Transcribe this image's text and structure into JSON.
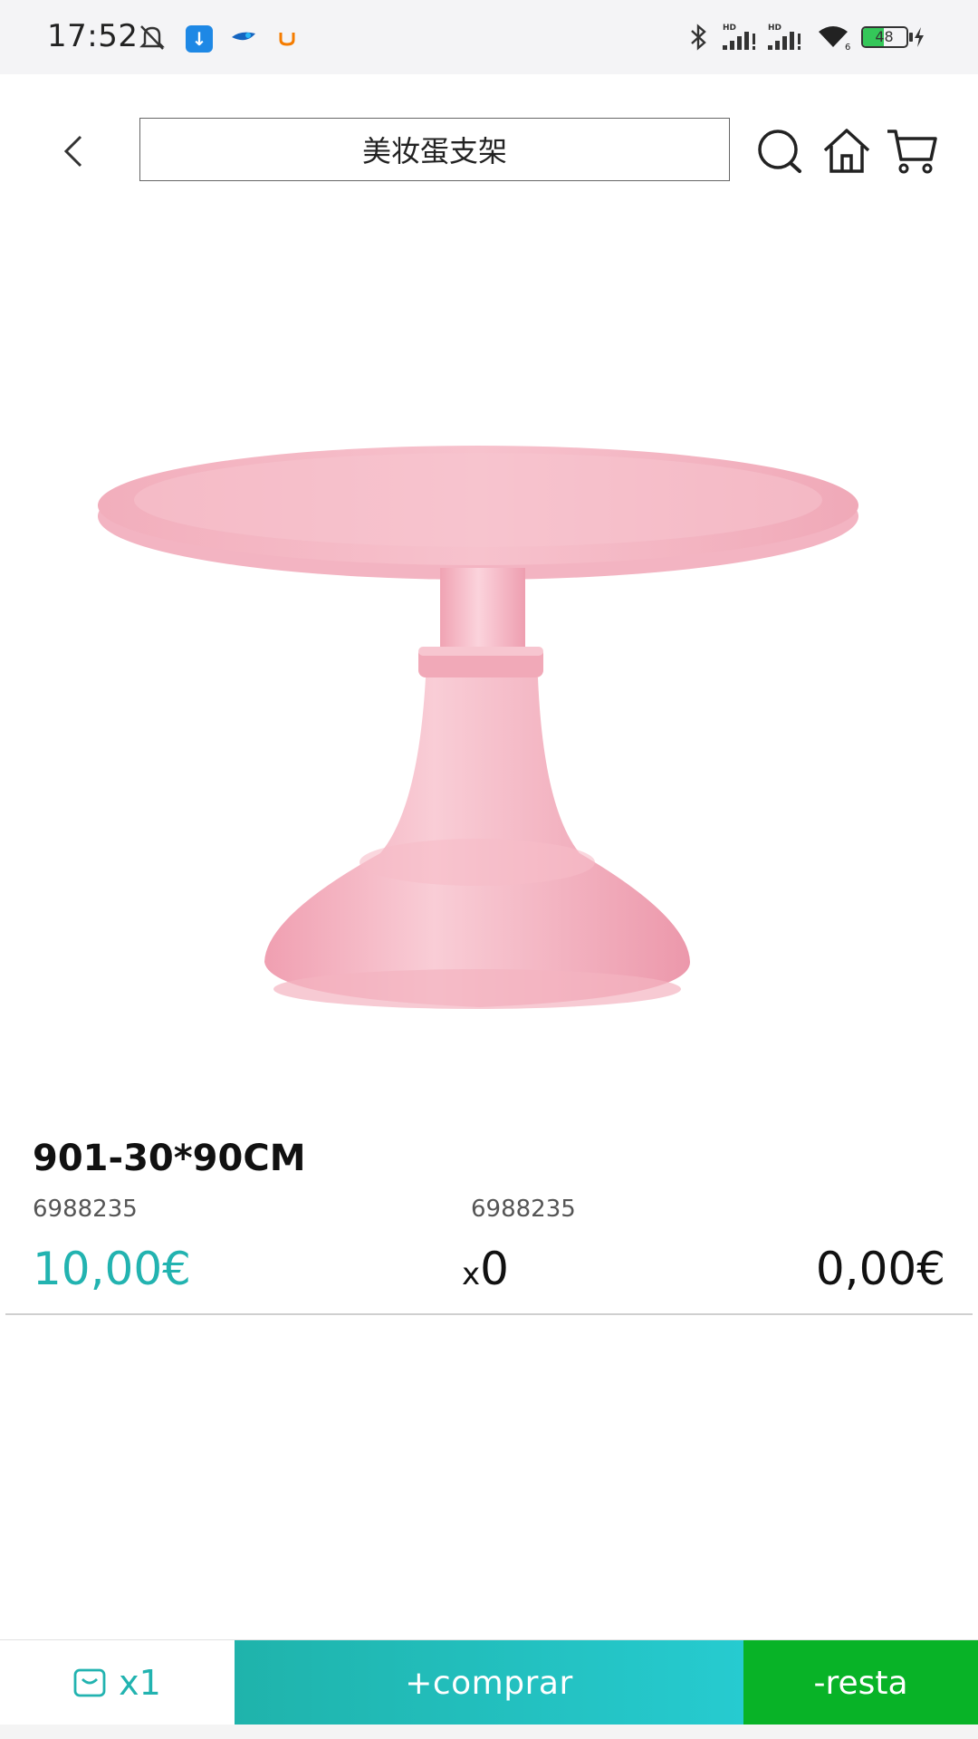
{
  "status_bar": {
    "time": "17:52",
    "battery_level": "48",
    "battery_fraction": 0.48,
    "signal_label": "HD"
  },
  "header": {
    "search_text": "美妆蛋支架"
  },
  "product": {
    "image_alt": "cake stand",
    "name": "901-30*90CM",
    "code_left": "6988235",
    "code_mid": "6988235",
    "price": "10,00€",
    "qty_prefix": "x",
    "qty_value": "0",
    "total": "0,00€"
  },
  "bottom_bar": {
    "cart_count": "x1",
    "buy_label": "+comprar",
    "minus_label": "-resta"
  },
  "colors": {
    "accent_teal": "#22b3b0",
    "buy_gradient_start": "#1fb3ab",
    "buy_gradient_end": "#26cbd0",
    "minus_green": "#08b327",
    "product_pink": "#f5b8c4"
  }
}
